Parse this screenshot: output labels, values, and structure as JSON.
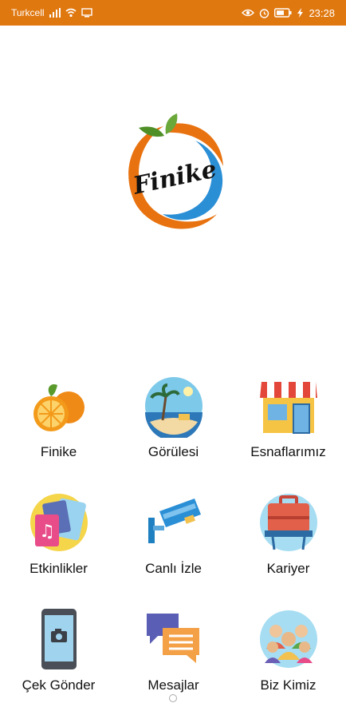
{
  "status_bar": {
    "carrier": "Turkcell",
    "time": "23:28",
    "icons": [
      "signal-icon",
      "wifi-icon",
      "screen-icon",
      "eye-icon",
      "alarm-icon",
      "battery-icon",
      "charging-icon"
    ]
  },
  "logo": {
    "text": "Finike",
    "colors": {
      "orange": "#e8720f",
      "blue": "#2b8fd6",
      "leaf": "#5a9a2c"
    }
  },
  "menu": {
    "items": [
      {
        "label": "Finike",
        "icon": "orange-fruit-icon"
      },
      {
        "label": "Görülesi",
        "icon": "beach-landscape-icon"
      },
      {
        "label": "Esnaflarımız",
        "icon": "shop-storefront-icon"
      },
      {
        "label": "Etkinlikler",
        "icon": "music-event-icon"
      },
      {
        "label": "Canlı İzle",
        "icon": "security-camera-icon"
      },
      {
        "label": "Kariyer",
        "icon": "briefcase-career-icon"
      },
      {
        "label": "Çek Gönder",
        "icon": "phone-camera-icon"
      },
      {
        "label": "Mesajlar",
        "icon": "chat-bubbles-icon"
      },
      {
        "label": "Biz Kimiz",
        "icon": "team-people-icon"
      }
    ]
  },
  "pager": {
    "pages": 1,
    "current": 1
  }
}
